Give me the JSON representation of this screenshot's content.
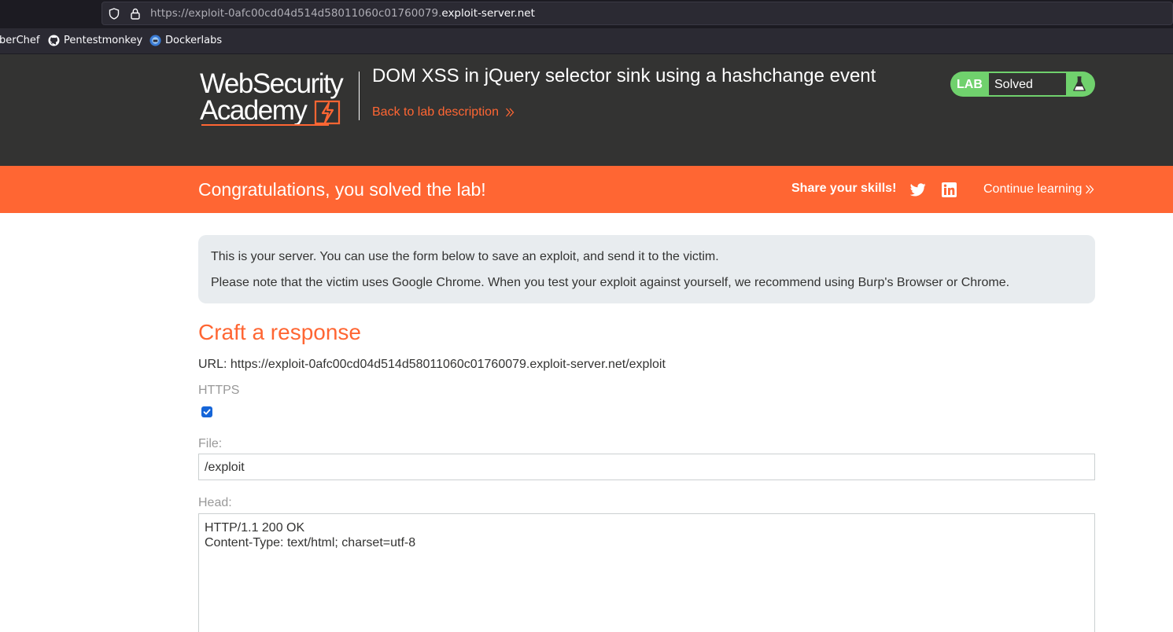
{
  "browser": {
    "url_prefix": "https://exploit-0afc00cd04d514d58011060c01760079.",
    "url_domain": "exploit-server.net",
    "bookmarks": [
      {
        "label": "berChef"
      },
      {
        "label": "Pentestmonkey"
      },
      {
        "label": "Dockerlabs"
      }
    ]
  },
  "header": {
    "logo_line1": "WebSecurity",
    "logo_line2": "Academy",
    "lab_title": "DOM XSS in jQuery selector sink using a hashchange event",
    "back_link": "Back to lab description",
    "status_lab": "LAB",
    "status_value": "Solved",
    "status_color": "#70d16d"
  },
  "banner": {
    "message": "Congratulations, you solved the lab!",
    "share_label": "Share your skills!",
    "continue_label": "Continue learning",
    "color": "#ff6633"
  },
  "info": {
    "line1": "This is your server. You can use the form below to save an exploit, and send it to the victim.",
    "line2": "Please note that the victim uses Google Chrome. When you test your exploit against yourself, we recommend using Burp's Browser or Chrome."
  },
  "form": {
    "heading": "Craft a response",
    "url_line": "URL: https://exploit-0afc00cd04d514d58011060c01760079.exploit-server.net/exploit",
    "https_label": "HTTPS",
    "https_checked": true,
    "file_label": "File:",
    "file_value": "/exploit",
    "head_label": "Head:",
    "head_line1": "HTTP/1.1 200 OK",
    "head_line2": "Content-Type: text/html; charset=utf-8"
  }
}
